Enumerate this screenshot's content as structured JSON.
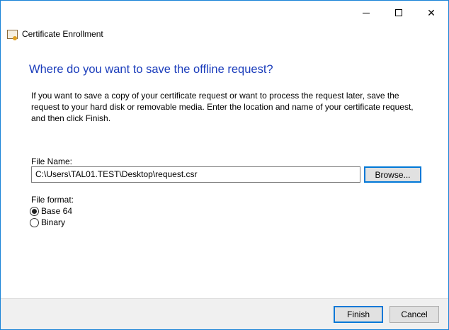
{
  "window": {
    "title": "Certificate Enrollment",
    "minimize_icon": "minimize-icon",
    "maximize_icon": "maximize-icon",
    "close_icon": "close-icon",
    "accent": "#0078d7"
  },
  "heading": "Where do you want to save the offline request?",
  "description": "If you want to save a copy of your certificate request or want to process the request later, save the request to your hard disk or removable media. Enter the location and name of your certificate request, and then click Finish.",
  "file_name": {
    "label": "File Name:",
    "value": "C:\\Users\\TAL01.TEST\\Desktop\\request.csr",
    "browse_label": "Browse..."
  },
  "file_format": {
    "label": "File format:",
    "options": [
      {
        "label": "Base 64",
        "selected": true
      },
      {
        "label": "Binary",
        "selected": false
      }
    ]
  },
  "footer": {
    "finish_label": "Finish",
    "cancel_label": "Cancel"
  }
}
